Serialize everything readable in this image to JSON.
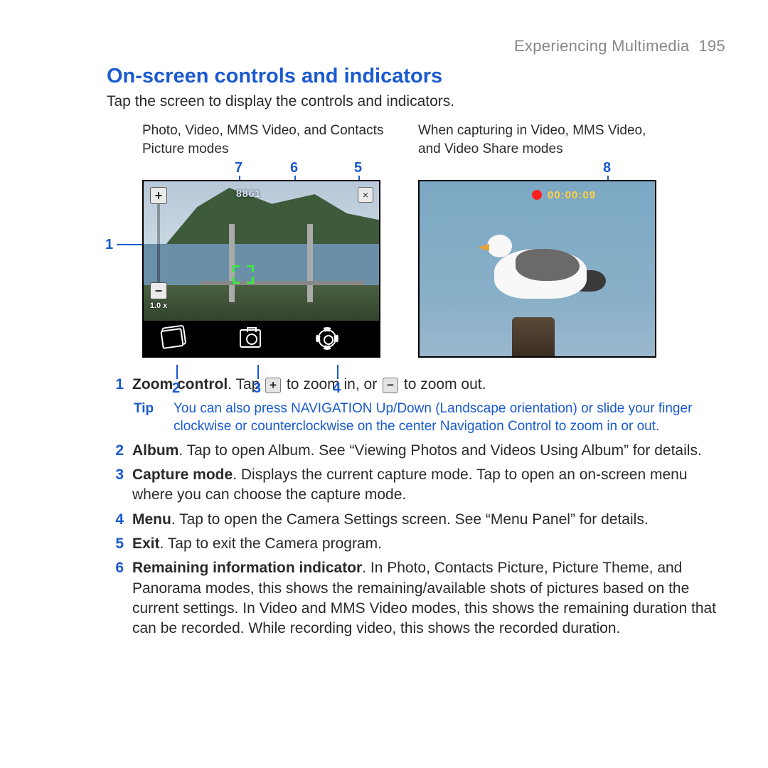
{
  "header": {
    "chapter": "Experiencing Multimedia",
    "page": "195"
  },
  "section_title": "On-screen controls and indicators",
  "intro": "Tap the screen to display the controls and indicators.",
  "fig": {
    "left_caption": "Photo, Video, MMS Video, and Contacts Picture modes",
    "right_caption": "When capturing in Video, MMS Video, and Video Share modes",
    "remaining_count": "8861",
    "zoom_level": "1.0 x",
    "rec_time": "00:00:09"
  },
  "callouts": {
    "c1": "1",
    "c2": "2",
    "c3": "3",
    "c4": "4",
    "c5": "5",
    "c6": "6",
    "c7": "7",
    "c8": "8"
  },
  "inline_icons": {
    "plus": "+",
    "minus": "−"
  },
  "items": {
    "i1": {
      "n": "1",
      "term": "Zoom control",
      "pre": ". Tap ",
      "mid": " to zoom in, or ",
      "post": " to zoom out."
    },
    "tip": {
      "label": "Tip",
      "text": "You can also press NAVIGATION Up/Down (Landscape orientation) or slide your finger clockwise or counterclockwise on the center Navigation Control to zoom in or out."
    },
    "i2": {
      "n": "2",
      "term": "Album",
      "text": ". Tap to open Album. See “Viewing Photos and Videos Using Album” for details."
    },
    "i3": {
      "n": "3",
      "term": "Capture mode",
      "text": ". Displays the current capture mode. Tap to open an on-screen menu where you can choose the capture mode."
    },
    "i4": {
      "n": "4",
      "term": "Menu",
      "text": ". Tap to open the Camera Settings screen. See “Menu Panel” for details."
    },
    "i5": {
      "n": "5",
      "term": "Exit",
      "text": ". Tap to exit the Camera program."
    },
    "i6": {
      "n": "6",
      "term": "Remaining information indicator",
      "text": ". In Photo, Contacts Picture, Picture Theme, and Panorama modes, this shows the remaining/available shots of pictures based on the current settings. In Video and MMS Video modes, this shows the remaining duration that can be recorded. While recording video, this shows the recorded duration."
    }
  }
}
